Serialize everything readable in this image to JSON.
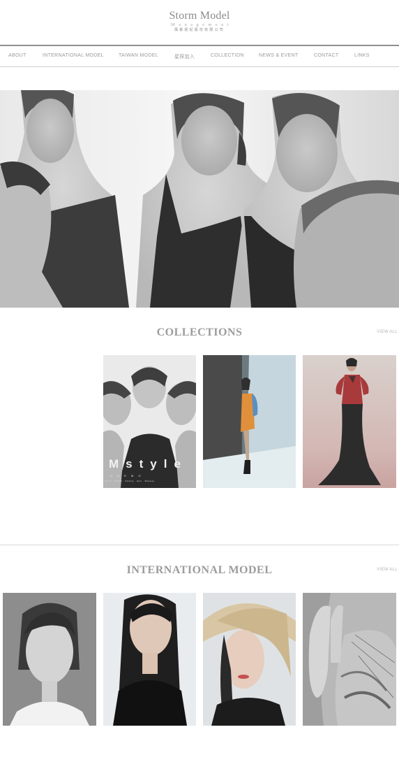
{
  "brand": {
    "name": "Storm Model",
    "sub": "Management",
    "chinese": "風暴經紀股份有限公司"
  },
  "nav": {
    "items": [
      {
        "label": "ABOUT"
      },
      {
        "label": "INTERNATIONAL MODEL"
      },
      {
        "label": "TAIWAN MODEL"
      },
      {
        "label": "星探加入"
      },
      {
        "label": "COLLECTION"
      },
      {
        "label": "NEWS & EVENT"
      },
      {
        "label": "CONTACT"
      },
      {
        "label": "LINKS"
      }
    ]
  },
  "collections": {
    "title": "COLLECTIONS",
    "view_all": "VIEW ALL",
    "cover_text": "Mstyle",
    "cover_sub": "O N E  M O",
    "cover_credits": "Photo · Model · Styling · Hair · Makeup"
  },
  "international": {
    "title": "INTERNATIONAL MODEL",
    "view_all": "VIEW ALL"
  },
  "colors": {
    "background": "#ffffff",
    "nav_rule": "#8f8f8f",
    "text_muted": "#9a9a9a"
  }
}
